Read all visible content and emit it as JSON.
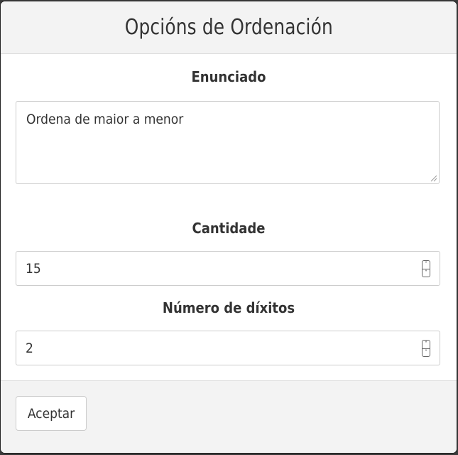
{
  "modal": {
    "title": "Opcións de Ordenación"
  },
  "fields": {
    "statement": {
      "label": "Enunciado",
      "value": "Ordena de maior a menor"
    },
    "quantity": {
      "label": "Cantidade",
      "value": "15"
    },
    "digits": {
      "label": "Número de díxitos",
      "value": "2"
    }
  },
  "footer": {
    "accept_label": "Aceptar"
  },
  "icons": {
    "spinner_up": "chevron-up-icon",
    "spinner_down": "chevron-down-icon",
    "resize": "resize-grip-icon"
  }
}
